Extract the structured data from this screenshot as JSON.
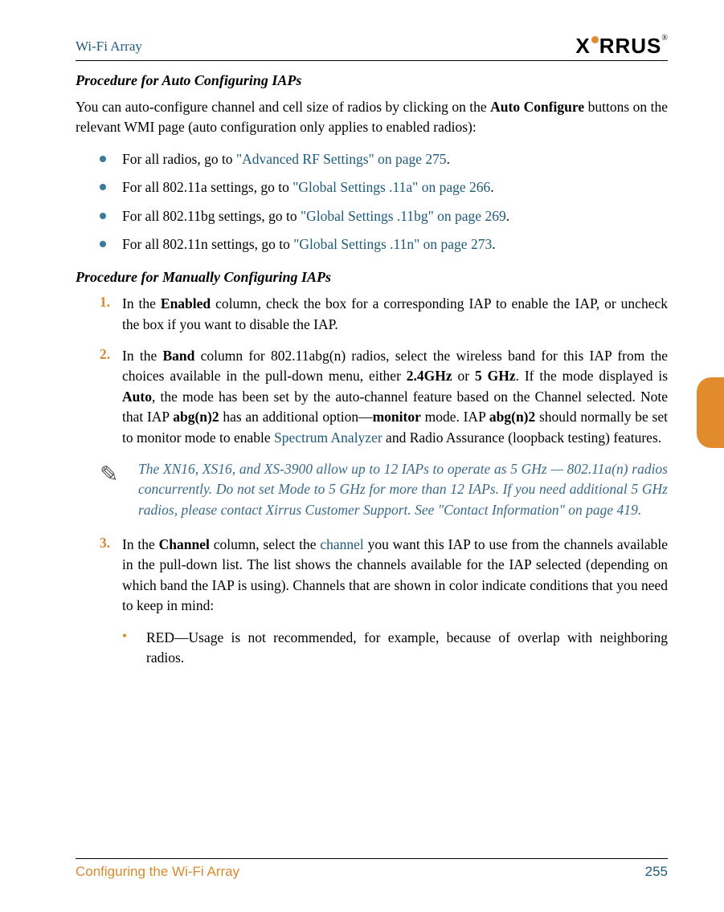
{
  "header": {
    "title": "Wi-Fi Array",
    "logo_text_left": "X",
    "logo_text_right": "RRUS",
    "logo_reg": "®"
  },
  "section1_heading": "Procedure for Auto Configuring IAPs",
  "section1_body_pre": "You can auto-configure channel and cell size of radios by clicking on the ",
  "section1_body_bold": "Auto Configure",
  "section1_body_post": " buttons on the relevant WMI page (auto configuration only applies to enabled radios):",
  "bullets": [
    {
      "pre": "For all radios, go to ",
      "link": "\"Advanced RF Settings\" on page 275",
      "post": "."
    },
    {
      "pre": "For all 802.11a settings, go to ",
      "link": "\"Global Settings .11a\" on page 266",
      "post": "."
    },
    {
      "pre": "For all 802.11bg settings, go to ",
      "link": "\"Global Settings .11bg\" on page 269",
      "post": "."
    },
    {
      "pre": "For all 802.11n settings, go to ",
      "link": "\"Global Settings .11n\" on page 273",
      "post": "."
    }
  ],
  "section2_heading": "Procedure for Manually Configuring IAPs",
  "step1": {
    "num": "1.",
    "pre": "In the ",
    "b1": "Enabled",
    "post": " column, check the box for a corresponding IAP to enable the IAP, or uncheck the box if you want to disable the IAP."
  },
  "step2": {
    "num": "2.",
    "t1": "In the ",
    "b1": "Band",
    "t2": " column for 802.11abg(n) radios, select the wireless band for this IAP from the choices available in the pull-down menu, either ",
    "b2": "2.4GHz",
    "t3": " or ",
    "b3": "5 GHz",
    "t4": ". If the mode displayed is ",
    "b4": "Auto",
    "t5": ", the mode has been set by the auto-channel feature based on the Channel selected. Note that IAP ",
    "b5": "abg(n)2",
    "t6": " has an additional option—",
    "b6": "monitor",
    "t7": " mode. IAP ",
    "b7": "abg(n)2",
    "t8": " should normally be set to monitor mode to enable ",
    "link": "Spectrum Analyzer",
    "t9": " and Radio Assurance (loopback testing) features."
  },
  "note": "The XN16, XS16, and XS-3900 allow up to 12 IAPs to operate as 5 GHz — 802.11a(n) radios concurrently. Do not set Mode to 5 GHz for more than 12 IAPs. If you need additional 5 GHz radios, please contact Xirrus Customer Support. See \"Contact Information\" on page 419.",
  "step3": {
    "num": "3.",
    "t1": "In the ",
    "b1": "Channel",
    "t2": " column, select the ",
    "link": "channel",
    "t3": " you want this IAP to use from the channels available in the pull-down list. The list shows the channels available for the IAP selected (depending on which band the IAP is using). Channels that are shown in color indicate conditions that you need to keep in mind:"
  },
  "sub_bullet": {
    "dot": "•",
    "text": "RED—Usage is not recommended, for example, because of overlap with neighboring radios."
  },
  "footer": {
    "left": "Configuring the Wi-Fi Array",
    "right": "255"
  }
}
